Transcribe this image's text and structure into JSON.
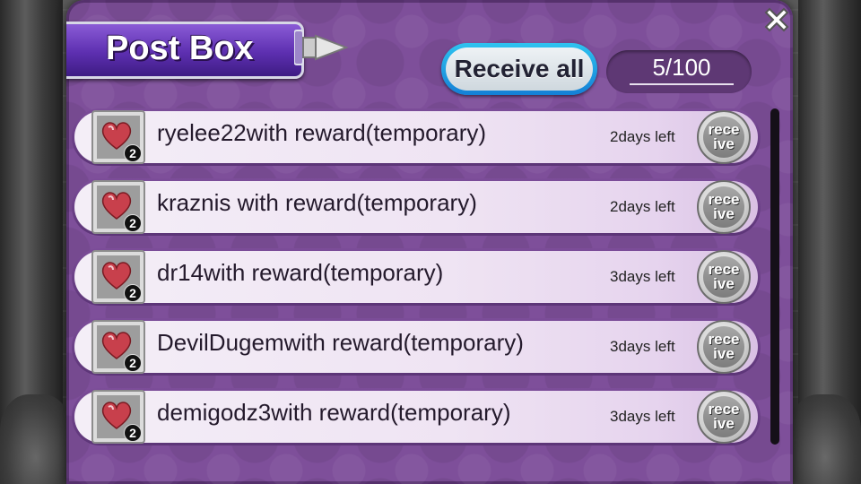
{
  "window": {
    "title": "Post Box",
    "close_icon": "close-x-icon"
  },
  "header": {
    "receive_all_label": "Receive all",
    "count": "5/100"
  },
  "colors": {
    "panel": "#7e4f9a",
    "banner": "#5d2fb0",
    "receive_all_border": "#1480d6"
  },
  "mail": [
    {
      "text": "ryelee22with reward(temporary)",
      "days": "2days left",
      "qty": "2",
      "icon": "heart-icon",
      "button": "receive"
    },
    {
      "text": "kraznis with reward(temporary)",
      "days": "2days left",
      "qty": "2",
      "icon": "heart-icon",
      "button": "receive"
    },
    {
      "text": "dr14with reward(temporary)",
      "days": "3days left",
      "qty": "2",
      "icon": "heart-icon",
      "button": "receive"
    },
    {
      "text": "DevilDugemwith reward(temporary)",
      "days": "3days left",
      "qty": "2",
      "icon": "heart-icon",
      "button": "receive"
    },
    {
      "text": "demigodz3with reward(temporary)",
      "days": "3days left",
      "qty": "2",
      "icon": "heart-icon",
      "button": "receive"
    }
  ]
}
